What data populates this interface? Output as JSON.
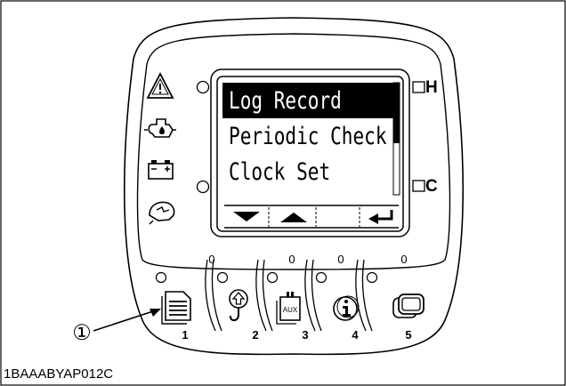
{
  "screen": {
    "menu_items": [
      "Log Record",
      "Periodic Check",
      "Clock Set"
    ],
    "selected_index": 0
  },
  "soft_keys": [
    "down-arrow",
    "up-arrow",
    "blank",
    "enter"
  ],
  "side_indicators": {
    "top": "H",
    "bottom": "C"
  },
  "warning_icons": [
    "warning-triangle-icon",
    "oil-pressure-icon",
    "battery-icon",
    "engine-speed-icon"
  ],
  "leds": [
    "0",
    "0",
    "0",
    "0"
  ],
  "buttons": [
    {
      "number": "1",
      "icon": "menu-list-icon"
    },
    {
      "number": "2",
      "icon": "hook-icon"
    },
    {
      "number": "3",
      "icon": "aux-icon",
      "icon_text": "AUX"
    },
    {
      "number": "4",
      "icon": "info-icon"
    },
    {
      "number": "5",
      "icon": "screen-toggle-icon"
    }
  ],
  "callout": "①",
  "document_code": "1BAAABYAP012C",
  "colors": {
    "line": "#000000",
    "background": "#ffffff",
    "highlight": "#000000"
  }
}
